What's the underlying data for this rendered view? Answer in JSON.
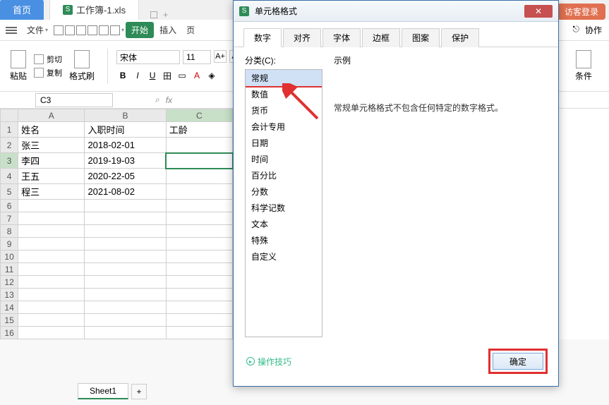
{
  "top": {
    "home_tab": "首页",
    "file_tab": "工作簿-1.xls",
    "guest_login": "访客登录"
  },
  "menu": {
    "file": "文件",
    "start": "开始",
    "insert": "插入",
    "page": "页",
    "collab": "协作",
    "cells": "条件"
  },
  "ribbon": {
    "paste": "粘贴",
    "cut": "剪切",
    "copy": "复制",
    "format_painter": "格式刷",
    "font_name": "宋体",
    "font_size": "11"
  },
  "formula": {
    "cell_ref": "C3"
  },
  "sheet": {
    "columns": [
      "A",
      "B",
      "C"
    ],
    "row_labels": [
      1,
      2,
      3,
      4,
      5,
      6,
      7,
      8,
      9,
      10,
      11,
      12,
      13,
      14,
      15,
      16
    ],
    "data": [
      [
        "姓名",
        "入职时间",
        "工龄"
      ],
      [
        "张三",
        "2018-02-01",
        ""
      ],
      [
        "李四",
        "2019-19-03",
        ""
      ],
      [
        "王五",
        "2020-22-05",
        ""
      ],
      [
        "程三",
        "2021-08-02",
        ""
      ]
    ],
    "active_sheet": "Sheet1",
    "selected": {
      "row": 3,
      "col": "C"
    }
  },
  "dialog": {
    "title": "单元格格式",
    "tabs": [
      "数字",
      "对齐",
      "字体",
      "边框",
      "图案",
      "保护"
    ],
    "active_tab": 0,
    "category_label": "分类(C):",
    "categories": [
      "常规",
      "数值",
      "货币",
      "会计专用",
      "日期",
      "时间",
      "百分比",
      "分数",
      "科学记数",
      "文本",
      "特殊",
      "自定义"
    ],
    "selected_category": 0,
    "example_label": "示例",
    "description": "常规单元格格式不包含任何特定的数字格式。",
    "tips": "操作技巧",
    "ok": "确定"
  }
}
